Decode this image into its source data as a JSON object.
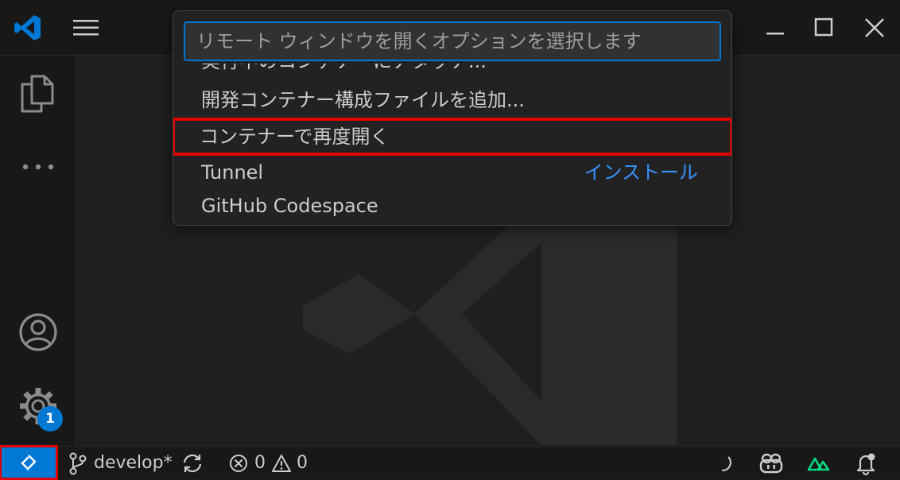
{
  "colors": {
    "accent": "#0078d4",
    "highlight": "#e00000",
    "link": "#3794ff",
    "nuxt_green": "#00dc82"
  },
  "quick_pick": {
    "placeholder": "リモート ウィンドウを開くオプションを選択します",
    "items": [
      {
        "label": "実行中のコンテナーにアタッチ..."
      },
      {
        "label": "開発コンテナー構成ファイルを追加..."
      },
      {
        "label": "コンテナーで再度開く",
        "highlighted": true
      },
      {
        "label": "Tunnel",
        "action": "インストール"
      },
      {
        "label": "GitHub Codespace"
      }
    ]
  },
  "activity_bar": {
    "settings_badge": "1"
  },
  "status_bar": {
    "branch": "develop*",
    "errors": "0",
    "warnings": "0"
  }
}
